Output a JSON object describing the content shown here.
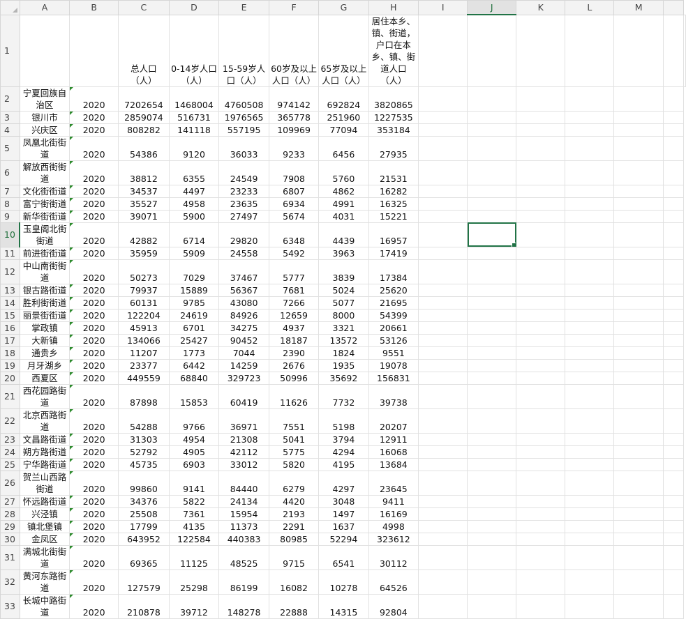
{
  "columns": [
    "A",
    "B",
    "C",
    "D",
    "E",
    "F",
    "G",
    "H",
    "I",
    "J",
    "K",
    "L",
    "M"
  ],
  "selected_cell": {
    "column": "J",
    "row": "10"
  },
  "header_row": {
    "row_number": "1",
    "cells": [
      "",
      "",
      "总人口（人）",
      "0-14岁人口（人）",
      "15-59岁人口（人）",
      "60岁及以上人口（人）",
      "65岁及以上人口（人）",
      "居住本乡、镇、街道，户口在本乡、镇、街道人口（人）"
    ]
  },
  "rows": [
    {
      "n": "2",
      "name": "宁夏回族自治区",
      "year": "2020",
      "v": [
        "7202654",
        "1468004",
        "4760508",
        "974142",
        "692824",
        "3820865"
      ]
    },
    {
      "n": "3",
      "name": "银川市",
      "year": "2020",
      "v": [
        "2859074",
        "516731",
        "1976565",
        "365778",
        "251960",
        "1227535"
      ]
    },
    {
      "n": "4",
      "name": "兴庆区",
      "year": "2020",
      "v": [
        "808282",
        "141118",
        "557195",
        "109969",
        "77094",
        "353184"
      ]
    },
    {
      "n": "5",
      "name": "凤凰北街街道",
      "year": "2020",
      "v": [
        "54386",
        "9120",
        "36033",
        "9233",
        "6456",
        "27935"
      ]
    },
    {
      "n": "6",
      "name": "解放西街街道",
      "year": "2020",
      "v": [
        "38812",
        "6355",
        "24549",
        "7908",
        "5760",
        "21531"
      ]
    },
    {
      "n": "7",
      "name": "文化街街道",
      "year": "2020",
      "v": [
        "34537",
        "4497",
        "23233",
        "6807",
        "4862",
        "16282"
      ]
    },
    {
      "n": "8",
      "name": "富宁街街道",
      "year": "2020",
      "v": [
        "35527",
        "4958",
        "23635",
        "6934",
        "4991",
        "16325"
      ]
    },
    {
      "n": "9",
      "name": "新华街街道",
      "year": "2020",
      "v": [
        "39071",
        "5900",
        "27497",
        "5674",
        "4031",
        "15221"
      ]
    },
    {
      "n": "10",
      "name": "玉皇阁北街街道",
      "year": "2020",
      "v": [
        "42882",
        "6714",
        "29820",
        "6348",
        "4439",
        "16957"
      ]
    },
    {
      "n": "11",
      "name": "前进街街道",
      "year": "2020",
      "v": [
        "35959",
        "5909",
        "24558",
        "5492",
        "3963",
        "17419"
      ]
    },
    {
      "n": "12",
      "name": "中山南街街道",
      "year": "2020",
      "v": [
        "50273",
        "7029",
        "37467",
        "5777",
        "3839",
        "17384"
      ]
    },
    {
      "n": "13",
      "name": "银古路街道",
      "year": "2020",
      "v": [
        "79937",
        "15889",
        "56367",
        "7681",
        "5024",
        "25620"
      ]
    },
    {
      "n": "14",
      "name": "胜利街街道",
      "year": "2020",
      "v": [
        "60131",
        "9785",
        "43080",
        "7266",
        "5077",
        "21695"
      ]
    },
    {
      "n": "15",
      "name": "丽景街街道",
      "year": "2020",
      "v": [
        "122204",
        "24619",
        "84926",
        "12659",
        "8000",
        "54399"
      ]
    },
    {
      "n": "16",
      "name": "掌政镇",
      "year": "2020",
      "v": [
        "45913",
        "6701",
        "34275",
        "4937",
        "3321",
        "20661"
      ]
    },
    {
      "n": "17",
      "name": "大新镇",
      "year": "2020",
      "v": [
        "134066",
        "25427",
        "90452",
        "18187",
        "13572",
        "53126"
      ]
    },
    {
      "n": "18",
      "name": "通贵乡",
      "year": "2020",
      "v": [
        "11207",
        "1773",
        "7044",
        "2390",
        "1824",
        "9551"
      ]
    },
    {
      "n": "19",
      "name": "月牙湖乡",
      "year": "2020",
      "v": [
        "23377",
        "6442",
        "14259",
        "2676",
        "1935",
        "19078"
      ]
    },
    {
      "n": "20",
      "name": "西夏区",
      "year": "2020",
      "v": [
        "449559",
        "68840",
        "329723",
        "50996",
        "35692",
        "156831"
      ]
    },
    {
      "n": "21",
      "name": "西花园路街道",
      "year": "2020",
      "v": [
        "87898",
        "15853",
        "60419",
        "11626",
        "7732",
        "39738"
      ]
    },
    {
      "n": "22",
      "name": "北京西路街道",
      "year": "2020",
      "v": [
        "54288",
        "9766",
        "36971",
        "7551",
        "5198",
        "20207"
      ]
    },
    {
      "n": "23",
      "name": "文昌路街道",
      "year": "2020",
      "v": [
        "31303",
        "4954",
        "21308",
        "5041",
        "3794",
        "12911"
      ]
    },
    {
      "n": "24",
      "name": "朔方路街道",
      "year": "2020",
      "v": [
        "52792",
        "4905",
        "42112",
        "5775",
        "4294",
        "16068"
      ]
    },
    {
      "n": "25",
      "name": "宁华路街道",
      "year": "2020",
      "v": [
        "45735",
        "6903",
        "33012",
        "5820",
        "4195",
        "13684"
      ]
    },
    {
      "n": "26",
      "name": "贺兰山西路街道",
      "year": "2020",
      "v": [
        "99860",
        "9141",
        "84440",
        "6279",
        "4297",
        "23645"
      ]
    },
    {
      "n": "27",
      "name": "怀远路街道",
      "year": "2020",
      "v": [
        "34376",
        "5822",
        "24134",
        "4420",
        "3048",
        "9411"
      ]
    },
    {
      "n": "28",
      "name": "兴泾镇",
      "year": "2020",
      "v": [
        "25508",
        "7361",
        "15954",
        "2193",
        "1497",
        "16169"
      ]
    },
    {
      "n": "29",
      "name": "镇北堡镇",
      "year": "2020",
      "v": [
        "17799",
        "4135",
        "11373",
        "2291",
        "1637",
        "4998"
      ]
    },
    {
      "n": "30",
      "name": "金凤区",
      "year": "2020",
      "v": [
        "643952",
        "122584",
        "440383",
        "80985",
        "52294",
        "323612"
      ]
    },
    {
      "n": "31",
      "name": "满城北街街道",
      "year": "2020",
      "v": [
        "69365",
        "11125",
        "48525",
        "9715",
        "6541",
        "30112"
      ]
    },
    {
      "n": "32",
      "name": "黄河东路街道",
      "year": "2020",
      "v": [
        "127579",
        "25298",
        "86199",
        "16082",
        "10278",
        "64526"
      ]
    },
    {
      "n": "33",
      "name": "长城中路街道",
      "year": "2020",
      "v": [
        "210878",
        "39712",
        "148278",
        "22888",
        "14315",
        "92804"
      ]
    }
  ]
}
